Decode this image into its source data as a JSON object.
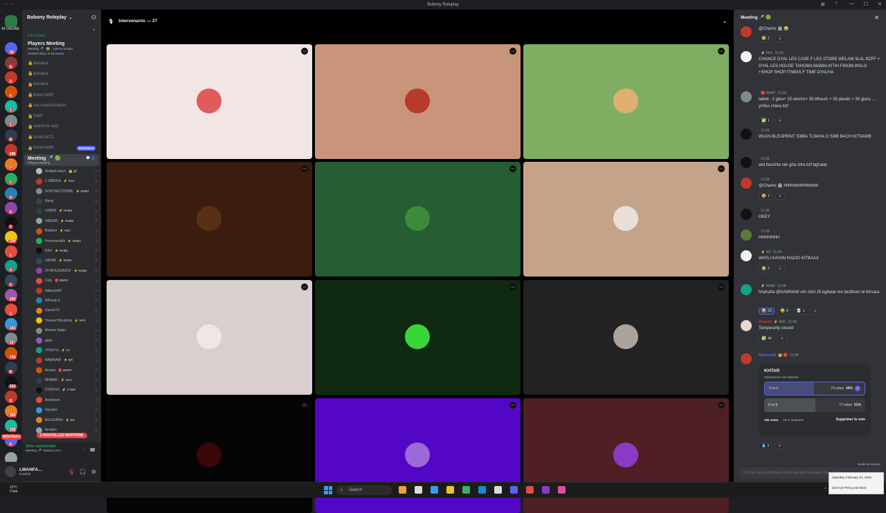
{
  "window": {
    "title": "Bobony Roleplay"
  },
  "rail": {
    "online_label": "43 ONLINE",
    "badges": [
      "32",
      "5",
      "2",
      "6",
      "1",
      "1",
      "8",
      "280",
      "7",
      "7",
      "4",
      "2",
      "1",
      "334",
      "1",
      "4",
      "1",
      "295",
      "3",
      "101",
      "16",
      "759",
      "6",
      "313",
      "2",
      "369",
      "339",
      "6"
    ],
    "nouveau_label": "NOUVEAU",
    "colors": [
      "#2d7d46",
      "#5865f2",
      "#8b3a3a",
      "#c0392b",
      "#d35400",
      "#1abc9c",
      "#7f8c8d",
      "#2c3e50",
      "#c0392b",
      "#e67e22",
      "#27ae60",
      "#2980b9",
      "#8e44ad",
      "#111111",
      "#f1c40f",
      "#e74c3c",
      "#16a085",
      "#34495e",
      "#9b59b6",
      "#e74c3c",
      "#3498db",
      "#7f8c8d",
      "#d35400",
      "#2c3e50",
      "#111111",
      "#c0392b",
      "#e67e22",
      "#1abc9c",
      "#5865f2",
      "#95a5a6"
    ]
  },
  "sidebar": {
    "server_name": "Bobony Roleplay",
    "event": {
      "live_label": "● En Direct",
      "title": "Players Meeting",
      "meta1": "Meeting 🎤 · 🟢 · 138 en écoute",
      "meta2": "VodkaFunky1 et 26 autres"
    },
    "channels": [
      {
        "name": "damana"
      },
      {
        "name": "damana"
      },
      {
        "name": "damana"
      },
      {
        "name": "ticket-9430"
      },
      {
        "name": "car-customization"
      },
      {
        "name": "hotel"
      },
      {
        "name": "switch-tx-cety"
      },
      {
        "name": "ticket-9472"
      },
      {
        "name": "ticket-9488",
        "badge": "NOUVEAU"
      }
    ],
    "voice_channel": {
      "name": "Meeting 🎤 🟢",
      "sub": "Players Meeting"
    },
    "voice_users": [
      {
        "name": "VodkaFunky1",
        "tag": "👑 🔊",
        "color": "#b5bac1"
      },
      {
        "name": "1 OMEGA",
        "tag": "⚡ AKS",
        "color": "#c0392b"
      },
      {
        "name": "GOOTEDTOOBIE",
        "tag": "⚡ NHB2",
        "color": "#7f8c8d"
      },
      {
        "name": "Reviz",
        "tag": "",
        "color": "#3f4147"
      },
      {
        "name": "LHINDI",
        "tag": "⚡ NHB2",
        "color": "#2c3e50"
      },
      {
        "name": "OMGIRI",
        "tag": "⚡ NHB2",
        "color": "#95a5a6"
      },
      {
        "name": "Bobbelt",
        "tag": "⚡ ARC",
        "color": "#d35400"
      },
      {
        "name": "Fenomenalla",
        "tag": "⚡ NHB2",
        "color": "#27ae60"
      },
      {
        "name": "DAX",
        "tag": "⚡ NHB2",
        "color": "#111111"
      },
      {
        "name": "ZAKA9",
        "tag": "⚡ NHB2",
        "color": "#34495e"
      },
      {
        "name": "24 MOUSSAOUI",
        "tag": "⚡ NHB2",
        "color": "#8e44ad"
      },
      {
        "name": "Cety",
        "tag": "🔴 BNRP",
        "color": "#e74c3c"
      },
      {
        "name": "Nahoule82",
        "tag": "",
        "color": "#c0392b"
      },
      {
        "name": "AlFredo II",
        "tag": "",
        "color": "#2980b9"
      },
      {
        "name": "DanasTV",
        "tag": "",
        "color": "#e67e22"
      },
      {
        "name": "Youssef Boushaq",
        "tag": "⚡ NPV",
        "color": "#f1c40f"
      },
      {
        "name": "Ahmed Sabiri",
        "tag": "",
        "color": "#7f8c8d"
      },
      {
        "name": "gitsh",
        "tag": "",
        "color": "#9b59b6"
      },
      {
        "name": "JYNX7rs",
        "tag": "⚡ X7",
        "color": "#16a085"
      },
      {
        "name": "NAWNAW",
        "tag": "⚡ BR",
        "color": "#c0392b"
      },
      {
        "name": "Alvario",
        "tag": "🔴 BNRP",
        "color": "#d35400"
      },
      {
        "name": "MHAMD",
        "tag": "⚡ AKS",
        "color": "#2c3e50"
      },
      {
        "name": "CORV1N",
        "tag": "⚡ CYBR",
        "color": "#111111"
      },
      {
        "name": "Anderson",
        "tag": "",
        "color": "#e74c3c"
      },
      {
        "name": "slyyutss",
        "tag": "",
        "color": "#3498db"
      },
      {
        "name": "BOUG4554",
        "tag": "⚡ BG",
        "color": "#e67e22"
      },
      {
        "name": "Ibrahim",
        "tag": "",
        "color": "#95a5a6"
      }
    ],
    "mentions_label": "2 NOUVELLES MENTIONS",
    "voice_connected": "Voix connectée",
    "voice_connected_sub": "Meeting 🎤 / Bobony Rol...",
    "user": {
      "name": "LMANFA...",
      "status": "Invisible"
    }
  },
  "stage": {
    "header": "Intervenants — 27",
    "tiles": [
      {
        "bg": "#f2e6e4",
        "av": "#e35a5a"
      },
      {
        "bg": "#c9957a",
        "av": "#b83a2a"
      },
      {
        "bg": "#7fae62",
        "av": "#e0b070"
      },
      {
        "bg": "#3a1d0f",
        "av": "#5a3015"
      },
      {
        "bg": "#265d32",
        "av": "#3d8a3a"
      },
      {
        "bg": "#c4a38b",
        "av": "#e8e0d8"
      },
      {
        "bg": "#d9cfcf",
        "av": "#f0e6e6"
      },
      {
        "bg": "#0f2a10",
        "av": "#39d639"
      },
      {
        "bg": "#222222",
        "av": "#a9a39b"
      },
      {
        "bg": "#050505",
        "av": "#3a0808"
      },
      {
        "bg": "#5406c6",
        "av": "#9a6ad6"
      },
      {
        "bg": "#4f1f26",
        "av": "#8a3bc4"
      }
    ]
  },
  "chat": {
    "title": "Meeting 🎤 🟢",
    "messages": [
      {
        "name": "",
        "time": "",
        "text": "@Chamo 🏛 😂",
        "av": "#c0392b",
        "reacts": [
          {
            "e": "😂",
            "n": "2"
          },
          {
            "e": "☺",
            "n": ""
          }
        ]
      },
      {
        "name": "",
        "tag": "⚡ AKS",
        "time": "21:08",
        "color": "#c0392b",
        "text": "CHANCE DYAL LES CASE F LES STORE WELAW 9LAL BZFF + DYAL LES HOUSE TAHOMA MAB9A KITIH FIHOM WALO\n+SHOP SHOP ITN9AS F TIME DYALHA",
        "av": "#f2f3f5",
        "reacts": []
      },
      {
        "name": "",
        "tag": "🔴 BNRP",
        "time": "21:08",
        "color": "#8e44ad",
        "text": "tablet : 2 gleu+ 15 electro+ 35 litheum + 35 plastic + 35 glass .... yn9so chwia bzf",
        "av": "#7f8c8d",
        "reacts": [
          {
            "e": "✅",
            "n": "1"
          },
          {
            "e": "☺",
            "n": ""
          }
        ]
      },
      {
        "name": "",
        "time": "21:08",
        "color": "#8e44ad",
        "text": "WLKN BLEUPRINT S3IBA TL9AHA O S3IB BACH KITSAWB",
        "av": "#111111",
        "reacts": []
      },
      {
        "name": "",
        "time": "21:08",
        "color": "#c0392b",
        "text": "wid bouchta rah gha chra bzf bghalat",
        "av": "#111111",
        "reacts": []
      },
      {
        "name": "",
        "time": "21:08",
        "color": "#8e44ad",
        "text": "@Chamo 🏛 hhhhhhhhhhhhhhh",
        "av": "#c0392b",
        "reacts": [
          {
            "e": "😂",
            "n": "1"
          },
          {
            "e": "☺",
            "n": ""
          }
        ]
      },
      {
        "name": "",
        "time": "21:08",
        "color": "#8e44ad",
        "text": "OKEY",
        "av": "#111111",
        "reacts": []
      },
      {
        "name": "",
        "time": "21:08",
        "color": "#8e44ad",
        "text": "HHHHHHH",
        "av": "#5a7a3a",
        "reacts": []
      },
      {
        "name": "",
        "tag": "⚡ NS",
        "time": "21:08",
        "color": "#8e44ad",
        "text": "WAYLI KAYAN RADIO KITBAA3",
        "av": "#f2f3f5",
        "reacts": [
          {
            "e": "😂",
            "n": "2"
          },
          {
            "e": "☺",
            "n": ""
          }
        ]
      },
      {
        "name": "",
        "tag": "⚡ NHB2",
        "time": "21:08",
        "color": "#8e44ad",
        "text": "hhahaha @NAWNAW reh chrit 25 bghalat rire be3thum bi lkhsara",
        "av": "#16a085",
        "reacts": [
          {
            "e": "😂",
            "n": "22"
          },
          {
            "e": "😂",
            "n": "8"
          },
          {
            "e": "💀",
            "n": "1"
          },
          {
            "e": "☺",
            "n": ""
          }
        ]
      },
      {
        "name": "Bobbelt",
        "tag": "⚡ ARC",
        "time": "21:09",
        "color": "#c0392b",
        "text": "Temporarily closed",
        "av": "#e8d8d0",
        "reacts": [
          {
            "e": "✅",
            "n": "48"
          },
          {
            "e": "☺",
            "n": ""
          }
        ]
      },
      {
        "name": "Nahoule82",
        "tag": "👑 🔴",
        "time": "21:09",
        "color": "#5865f2",
        "text": "",
        "av": "#c0392b",
        "reacts": []
      }
    ],
    "poll": {
      "question": "KHTAR",
      "hint": "Sélectionne une réponse",
      "answers": [
        {
          "label": "6 vs 6",
          "votes": "73 votes",
          "pct": "49%",
          "fill": 0.49,
          "selected": true
        },
        {
          "label": "8 vs 8",
          "votes": "77 votes",
          "pct": "51%",
          "fill": 0.51,
          "selected": false
        }
      ],
      "total": "150 votes",
      "remaining": "59 m restantes",
      "remove_label": "Supprimer le vote",
      "react": {
        "e": "💧",
        "n": "1"
      }
    },
    "slow_mode": "Mode lent activé",
    "input_placeholder": "Tu n'as pas la permission d'envoyer des messages dans ce sa..."
  },
  "taskbar": {
    "weather_temp": "13°C",
    "weather_desc": "Clear",
    "search_label": "Search",
    "tooltip_date": "Saturday, February 21, 2026",
    "tooltip_time": "Sat 9:10 PM (Local time)",
    "apps": [
      "#e8a33a",
      "#dcdcdc",
      "#3a9bf0",
      "#e8c33a",
      "#3ab06a",
      "#1a8ad0",
      "#dcdcdc",
      "#5865f2",
      "#e04a4a",
      "#8a3bc4",
      "#e04aa0"
    ]
  }
}
